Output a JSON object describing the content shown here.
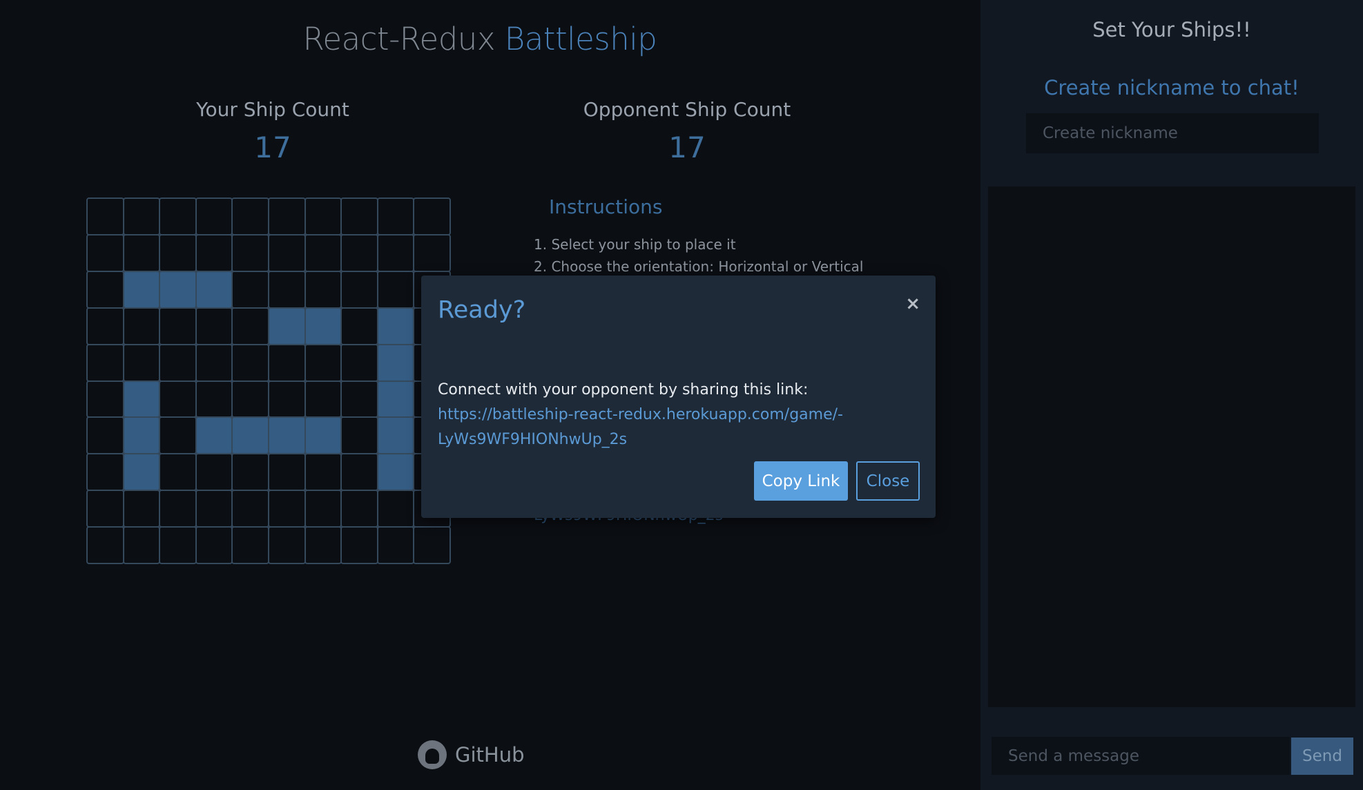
{
  "header": {
    "title_part1": "React-Redux",
    "title_part2": "Battleship"
  },
  "counts": {
    "yours": {
      "label": "Your Ship Count",
      "value": "17"
    },
    "opponent": {
      "label": "Opponent Ship Count",
      "value": "17"
    }
  },
  "board": {
    "rows": 10,
    "cols": 10,
    "ship_cells": [
      [
        2,
        1
      ],
      [
        2,
        2
      ],
      [
        2,
        3
      ],
      [
        3,
        5
      ],
      [
        3,
        6
      ],
      [
        3,
        8
      ],
      [
        4,
        8
      ],
      [
        5,
        1
      ],
      [
        5,
        8
      ],
      [
        6,
        1
      ],
      [
        6,
        3
      ],
      [
        6,
        4
      ],
      [
        6,
        5
      ],
      [
        6,
        6
      ],
      [
        6,
        8
      ],
      [
        7,
        1
      ],
      [
        7,
        8
      ]
    ]
  },
  "instructions": {
    "heading": "Instructions",
    "items": [
      "1. Select your ship to place it",
      "2. Choose the orientation: Horizontal or Vertical"
    ],
    "link_fragment": "LyWs9WF9HIONhwUp_2s"
  },
  "footer": {
    "github_label": "GitHub"
  },
  "sidebar": {
    "title": "Set Your Ships!!",
    "chat_cta": "Create nickname to chat!",
    "nickname_placeholder": "Create nickname",
    "message_placeholder": "Send a message",
    "send_label": "Send"
  },
  "modal": {
    "title": "Ready?",
    "close_icon": "×",
    "body_text": "Connect with your opponent by sharing this link: ",
    "link": "https://battleship-react-redux.herokuapp.com/game/-LyWs9WF9HIONhwUp_2s",
    "copy_label": "Copy Link",
    "close_label": "Close"
  }
}
